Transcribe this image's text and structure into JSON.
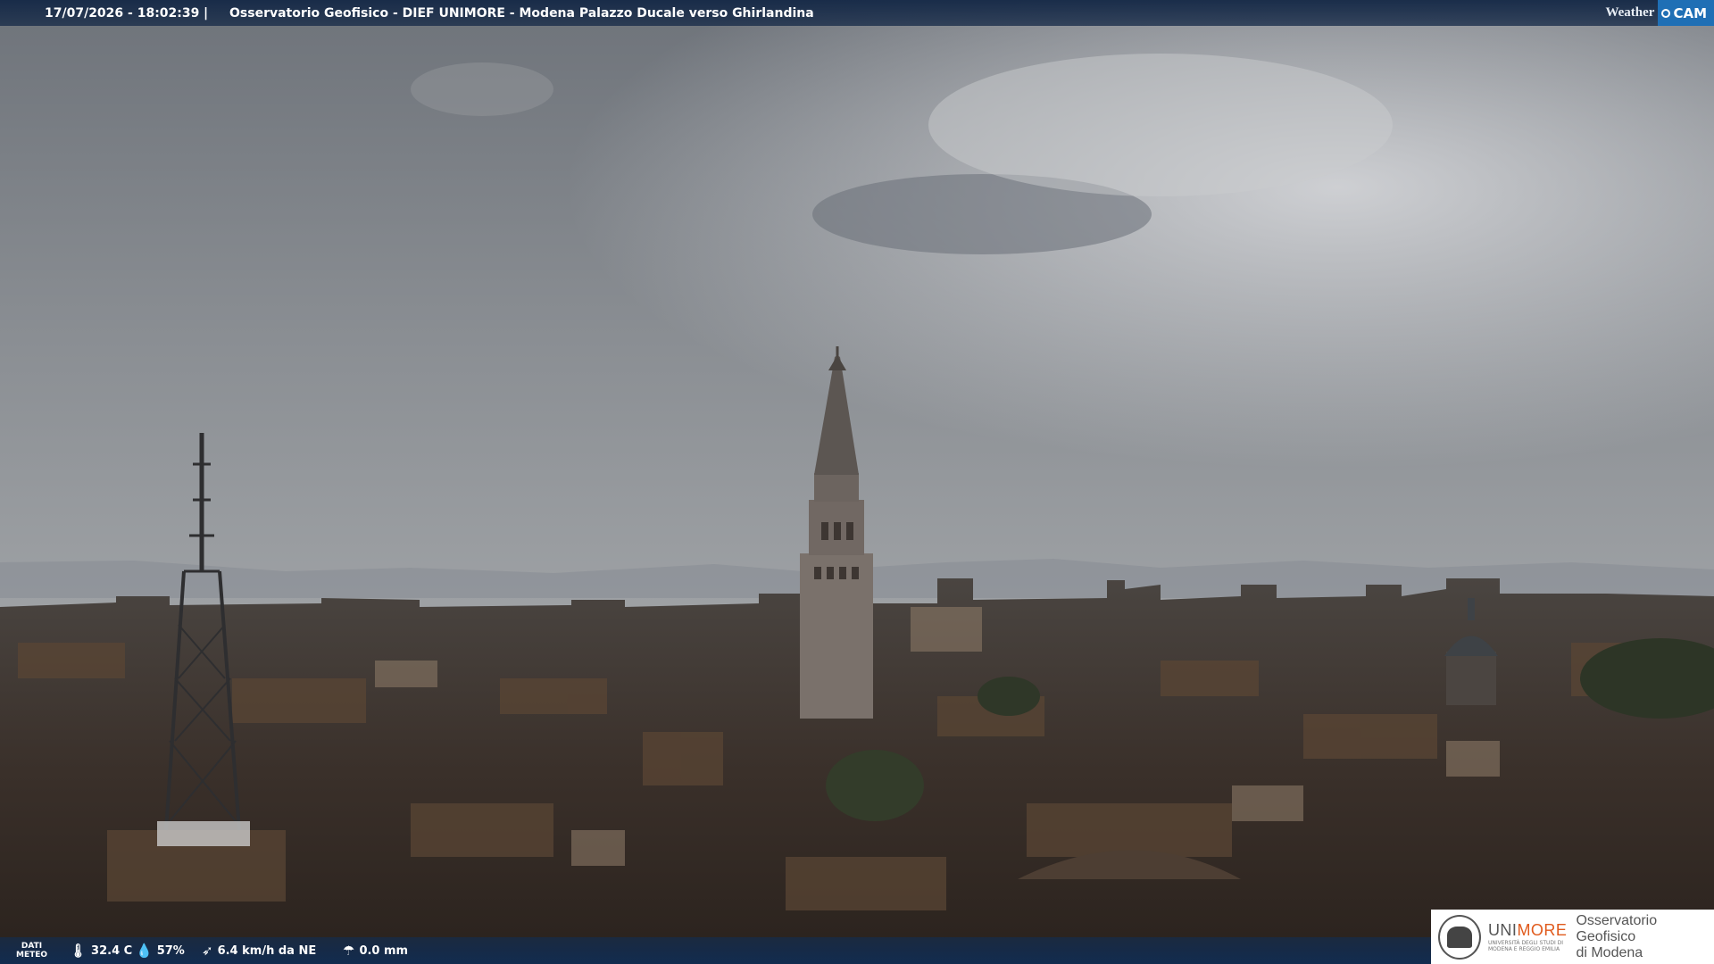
{
  "header": {
    "timestamp": "17/07/2026 - 18:02:39",
    "separator": "|",
    "title": "Osservatorio Geofisico - DIEF UNIMORE - Modena Palazzo Ducale verso Ghirlandina",
    "brand_weather": "Weather",
    "brand_cam": "CAM"
  },
  "weather": {
    "label_line1": "DATI",
    "label_line2": "METEO",
    "temperature": "32.4 C",
    "humidity": "57%",
    "wind": "6.4 km/h da NE",
    "rain": "0.0 mm",
    "icons": [
      "thermometer-icon",
      "humidity-drop-icon",
      "wind-icon",
      "rain-icon"
    ]
  },
  "logo": {
    "uni_part1": "UNI",
    "uni_part2": "MORE",
    "uni_sub1": "UNIVERSITÀ DEGLI STUDI DI",
    "uni_sub2": "MODENA E REGGIO EMILIA",
    "obs_line1": "Osservatorio Geofisico",
    "obs_line2": "di Modena"
  },
  "colors": {
    "bar_blue": "#143b66",
    "unimore_orange": "#e05a1c",
    "brand_blue": "#1f6fb5"
  }
}
